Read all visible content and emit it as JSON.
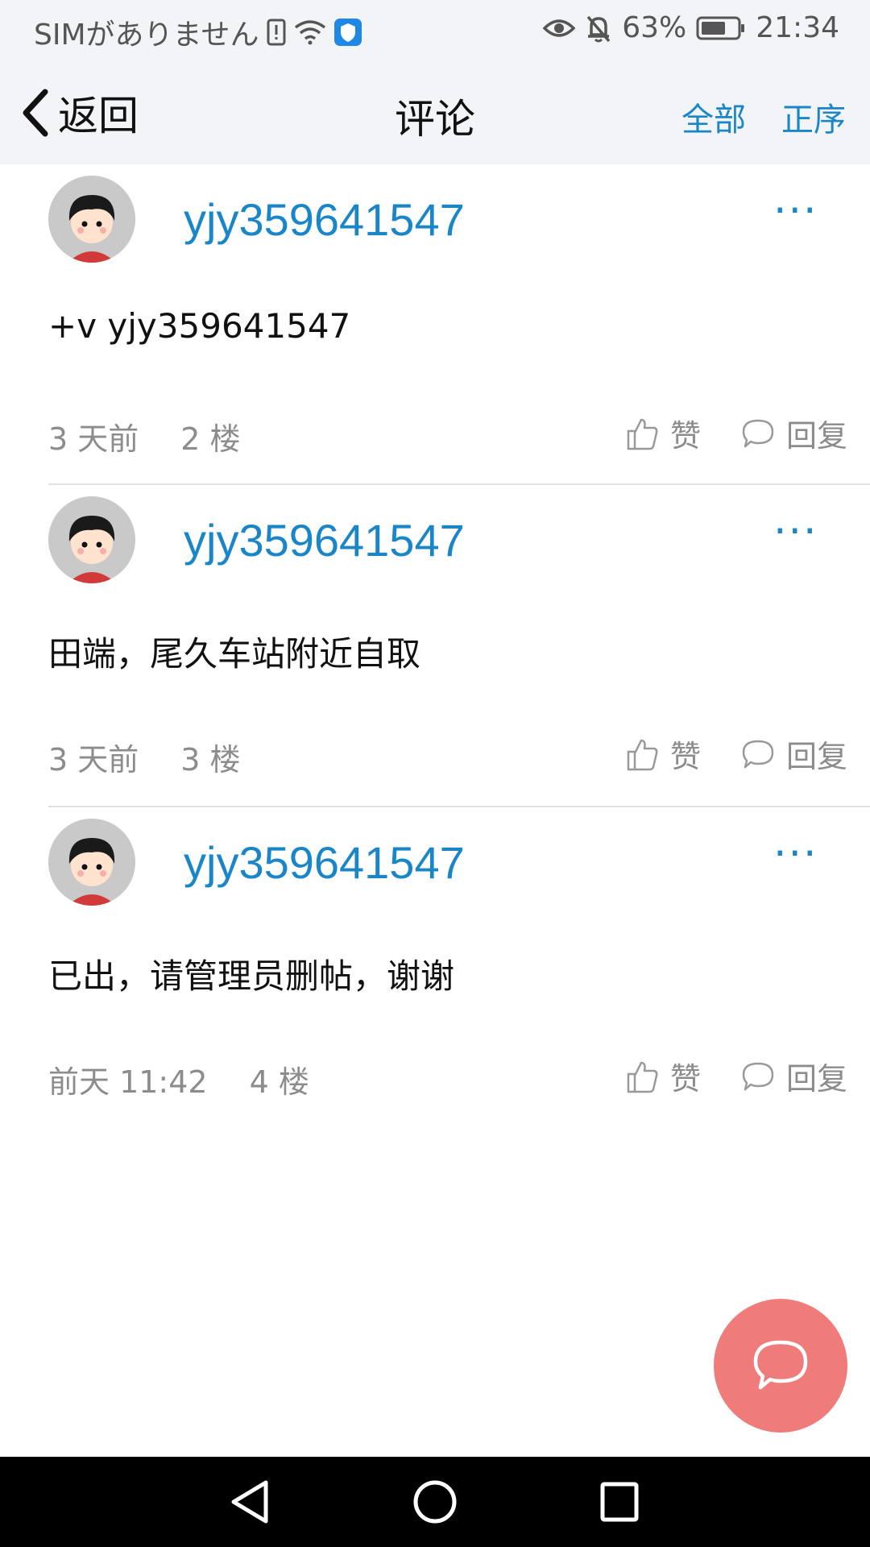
{
  "status_bar": {
    "sim_text": "SIMがありません",
    "battery_percent": "63%",
    "time": "21:34"
  },
  "nav": {
    "back_label": "返回",
    "title": "评论",
    "filter_label": "全部",
    "order_label": "正序"
  },
  "comments": [
    {
      "username": "yjy359641547",
      "text": "+v   yjy359641547",
      "time": "3 天前",
      "floor": "2 楼",
      "like_label": "赞",
      "reply_label": "回复"
    },
    {
      "username": "yjy359641547",
      "text": "田端，尾久车站附近自取",
      "time": "3 天前",
      "floor": "3 楼",
      "like_label": "赞",
      "reply_label": "回复"
    },
    {
      "username": "yjy359641547",
      "text": "已出，请管理员删帖，谢谢",
      "time": "前天 11:42",
      "floor": "4 楼",
      "like_label": "赞",
      "reply_label": "回复"
    }
  ],
  "more_label": "···",
  "colors": {
    "accent": "#1a86c8",
    "fab": "#ef7b7b"
  }
}
